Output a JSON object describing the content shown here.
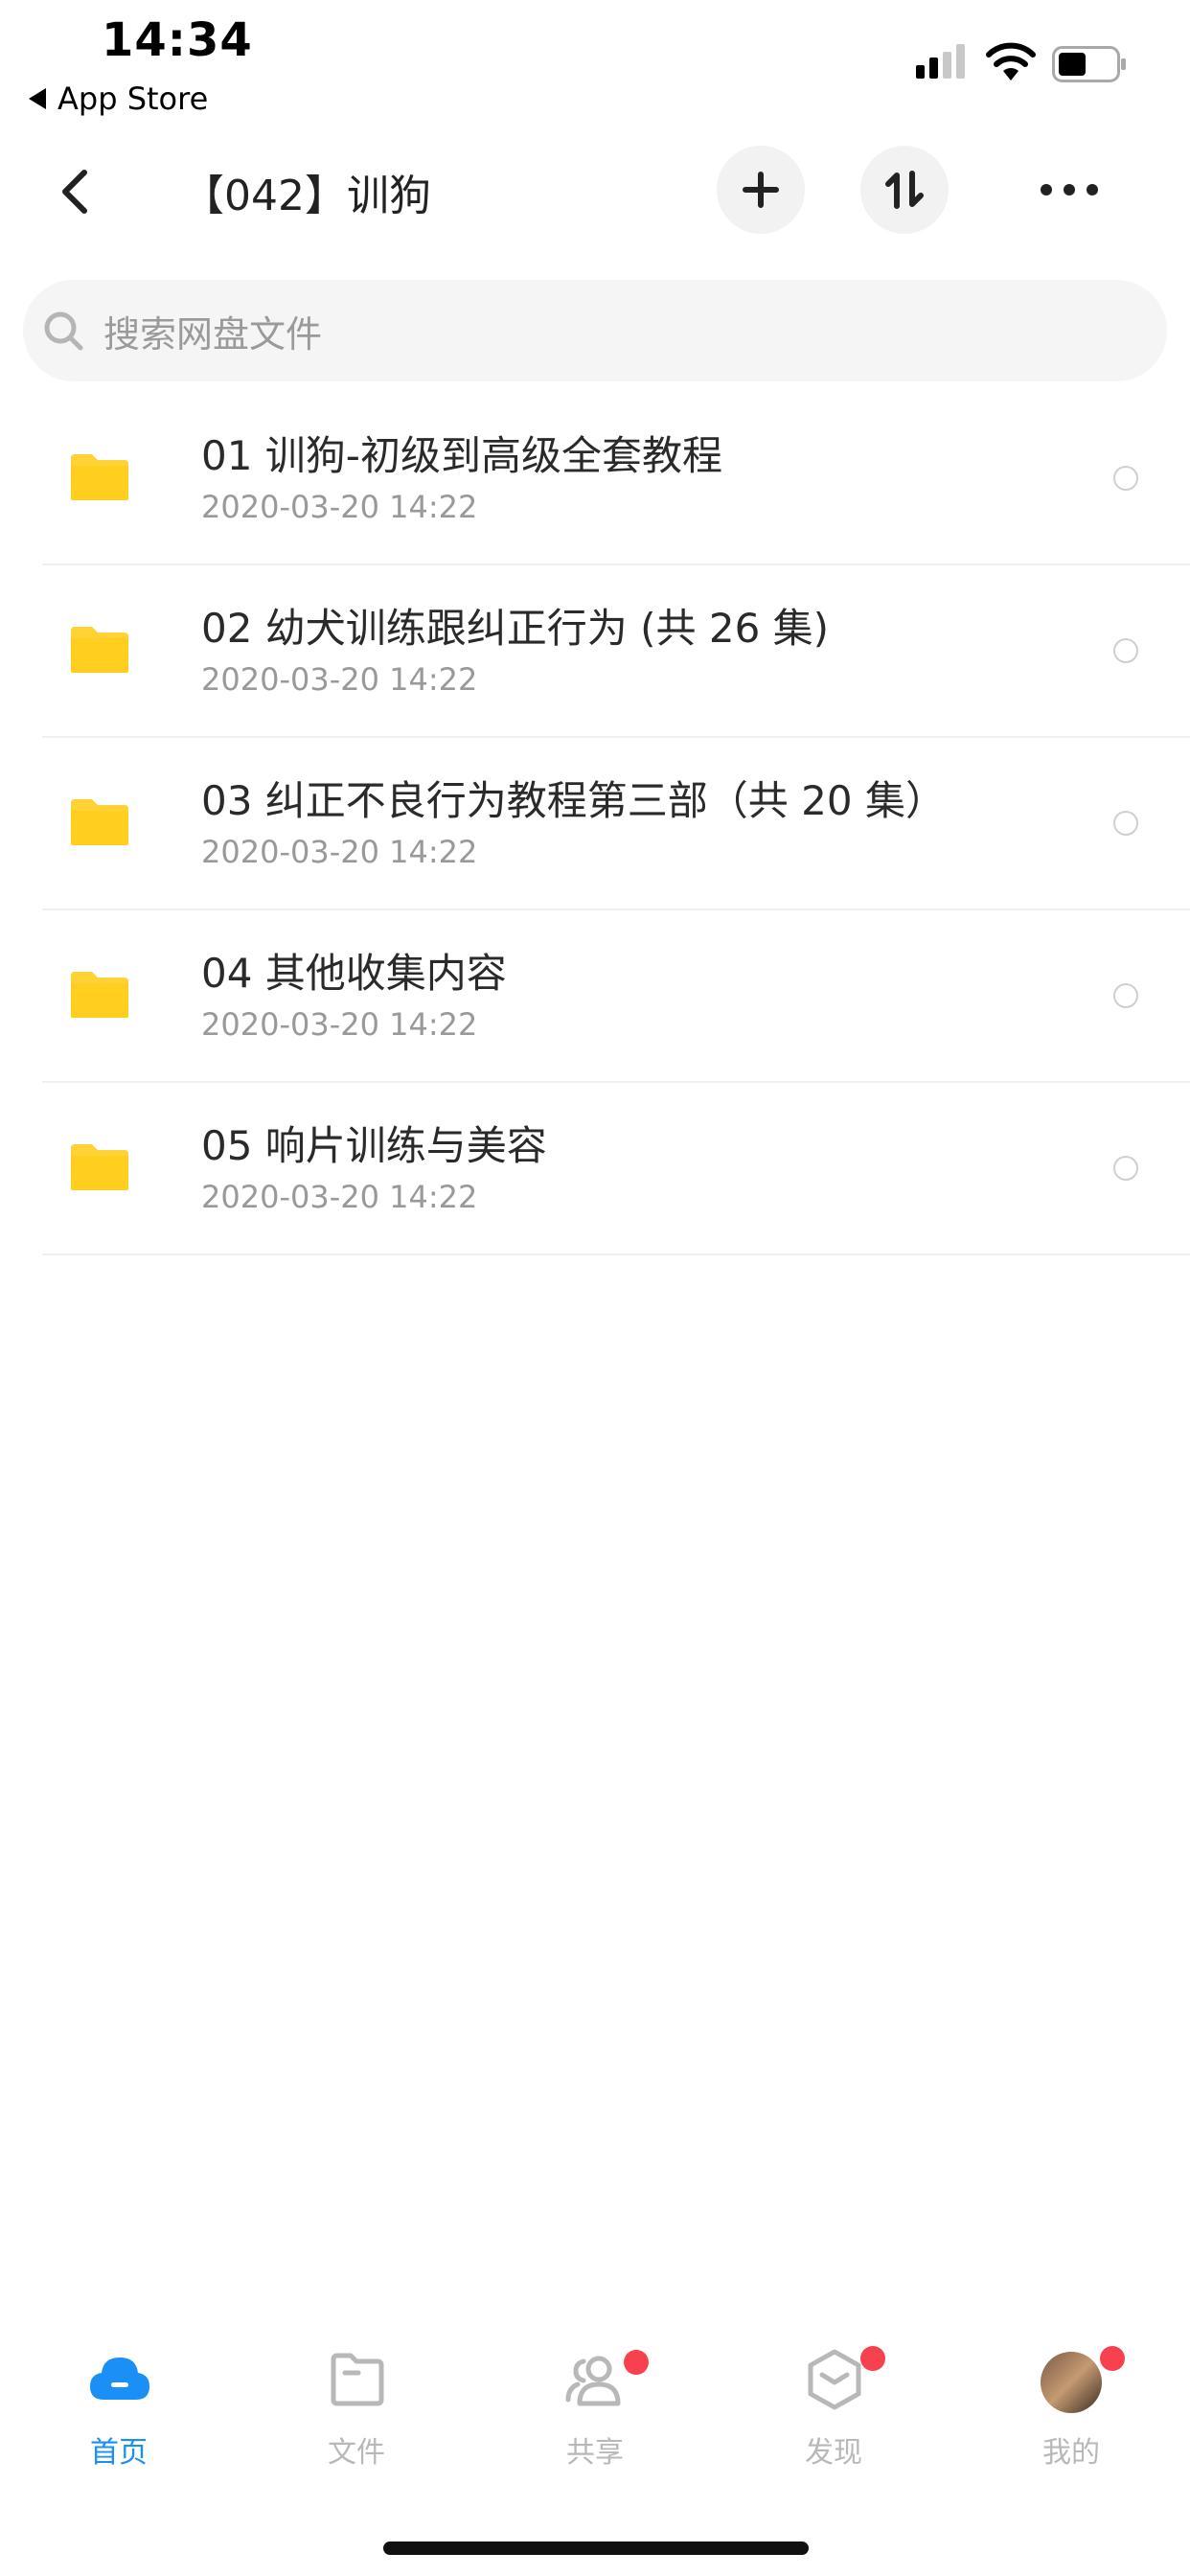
{
  "status": {
    "time": "14:34",
    "back_label": "App Store"
  },
  "nav": {
    "title": "【042】训狗",
    "back_icon": "chevron-left-icon",
    "add_icon": "plus-icon",
    "sort_icon": "transfer-icon",
    "more_icon": "more-dots-icon"
  },
  "search": {
    "placeholder": "搜索网盘文件"
  },
  "files": [
    {
      "name": "01 训狗-初级到高级全套教程",
      "date": "2020-03-20 14:22"
    },
    {
      "name": "02 幼犬训练跟纠正行为 (共 26 集)",
      "date": "2020-03-20 14:22"
    },
    {
      "name": "03 纠正不良行为教程第三部（共 20 集）",
      "date": "2020-03-20 14:22"
    },
    {
      "name": "04 其他收集内容",
      "date": "2020-03-20 14:22"
    },
    {
      "name": "05 响片训练与美容",
      "date": "2020-03-20 14:22"
    }
  ],
  "tabs": [
    {
      "label": "首页",
      "icon": "cloud-icon",
      "active": true
    },
    {
      "label": "文件",
      "icon": "folder-icon"
    },
    {
      "label": "共享",
      "icon": "users-icon",
      "badge": true
    },
    {
      "label": "发现",
      "icon": "discover-box-icon",
      "badge": true
    },
    {
      "label": "我的",
      "icon": "avatar-icon",
      "badge": true
    }
  ],
  "colors": {
    "accent": "#1a8ff5",
    "folder": "#ffd335",
    "badge": "#f8414e"
  }
}
